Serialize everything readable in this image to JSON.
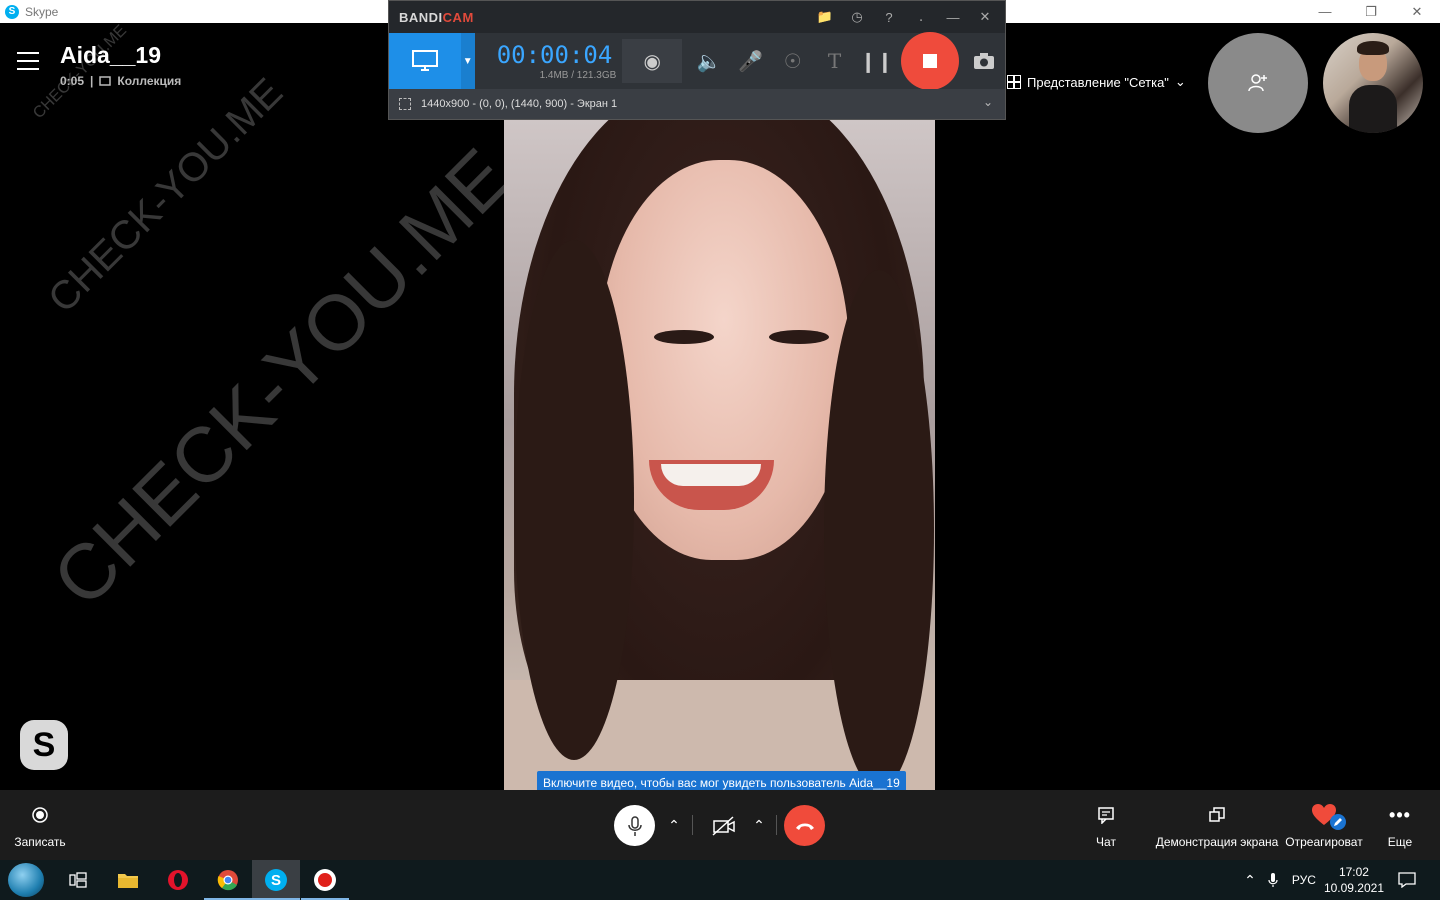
{
  "window": {
    "title": "Skype"
  },
  "call": {
    "contact_name": "Aida__19",
    "duration": "0:05",
    "separator": "|",
    "collection_label": "Коллекция",
    "grid_view_label": "Представление \"Сетка\"",
    "grid_view_chevron": "⌄"
  },
  "watermark": {
    "text": "CHECK-YOU.ME"
  },
  "bandicam": {
    "logo_a": "BANDI",
    "logo_b": "CAM",
    "timer": "00:00:04",
    "size": "1.4MB / 121.3GB",
    "region": "1440x900 - (0, 0), (1440, 900) - Экран 1"
  },
  "tooltip": {
    "text": "Включите видео, чтобы вас мог увидеть пользователь Aida__19"
  },
  "callbar": {
    "record_label": "Записать",
    "chat_label": "Чат",
    "share_label": "Демонстрация экрана",
    "react_label": "Отреагироват",
    "more_label": "Еще"
  },
  "taskbar": {
    "language": "РУС",
    "time": "17:02",
    "date": "10.09.2021"
  },
  "colors": {
    "hangup": "#f04b3b",
    "bandicam_accent": "#1e8fe8",
    "tooltip": "#1a73d1",
    "heart": "#f04b3b"
  }
}
